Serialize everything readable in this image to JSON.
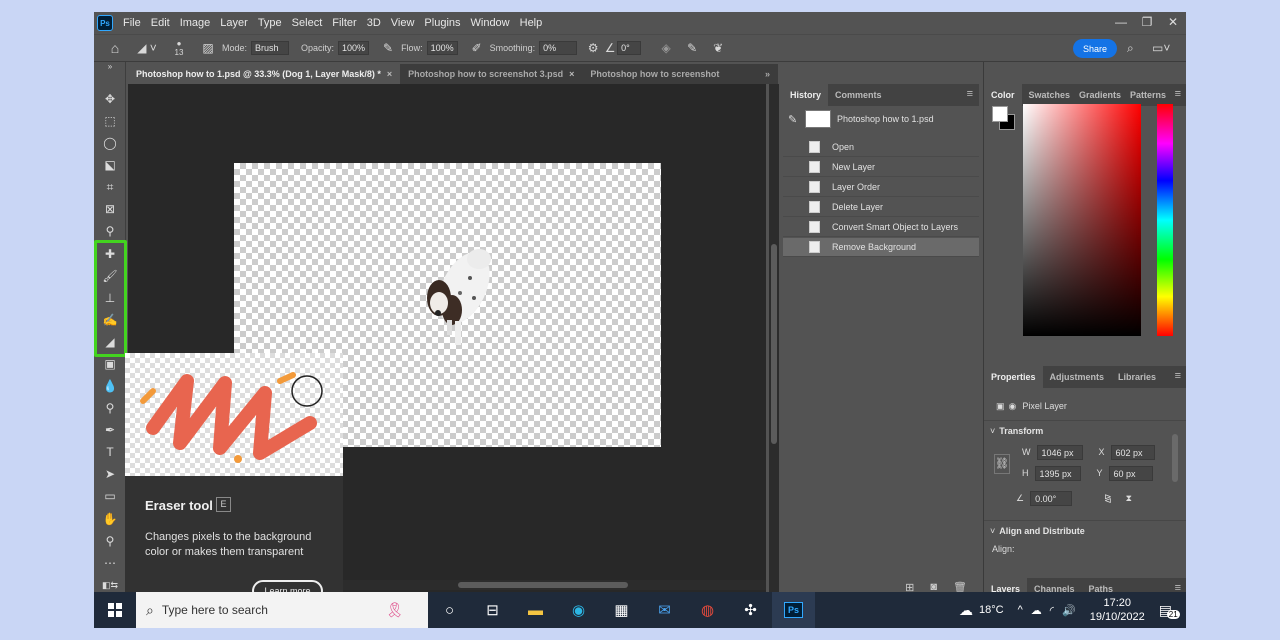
{
  "menubar": {
    "logo": "Ps",
    "items": [
      "File",
      "Edit",
      "Image",
      "Layer",
      "Type",
      "Select",
      "Filter",
      "3D",
      "View",
      "Plugins",
      "Window",
      "Help"
    ]
  },
  "options": {
    "brush_size": "13",
    "mode_label": "Mode:",
    "mode_value": "Brush",
    "opacity_label": "Opacity:",
    "opacity_value": "100%",
    "flow_label": "Flow:",
    "flow_value": "100%",
    "smoothing_label": "Smoothing:",
    "smoothing_value": "0%",
    "angle_value": "0°",
    "share_label": "Share"
  },
  "tabs": [
    {
      "label": "Photoshop how to 1.psd @ 33.3% (Dog 1, Layer Mask/8) *",
      "active": true,
      "close": "×"
    },
    {
      "label": "Photoshop how to screenshot 3.psd",
      "active": false,
      "close": "×"
    },
    {
      "label": "Photoshop how to screenshot",
      "active": false,
      "close": ""
    }
  ],
  "tabs_overflow": "»",
  "tooltip": {
    "title": "Eraser tool",
    "shortcut": "E",
    "description": "Changes pixels to the background color or makes them transparent",
    "button": "Learn more"
  },
  "history_panel": {
    "tabs": [
      "History",
      "Comments"
    ],
    "snapshot": "Photoshop how to 1.psd",
    "steps": [
      "Open",
      "New Layer",
      "Layer Order",
      "Delete Layer",
      "Convert Smart Object to Layers",
      "Remove Background"
    ],
    "selected_index": 5
  },
  "color_panel": {
    "tabs": [
      "Color",
      "Swatches",
      "Gradients",
      "Patterns"
    ],
    "foreground": "#ffffff",
    "background": "#000000"
  },
  "properties_panel": {
    "tabs": [
      "Properties",
      "Adjustments",
      "Libraries"
    ],
    "layer_type": "Pixel Layer",
    "transform_title": "Transform",
    "w_label": "W",
    "w_value": "1046 px",
    "h_label": "H",
    "h_value": "1395 px",
    "x_label": "X",
    "x_value": "602 px",
    "y_label": "Y",
    "y_value": "60 px",
    "angle_value": "0.00°",
    "align_title": "Align and Distribute",
    "align_label": "Align:"
  },
  "layers_panel": {
    "tabs": [
      "Layers",
      "Channels",
      "Paths"
    ]
  },
  "taskbar": {
    "search_placeholder": "Type here to search",
    "weather": "18°C",
    "time": "17:20",
    "date": "19/10/2022",
    "notifications": "21",
    "apps": [
      "task-view-icon",
      "widgets-icon",
      "file-explorer-icon",
      "edge-icon",
      "store-icon",
      "mail-icon",
      "chrome-icon",
      "slack-icon",
      "photoshop-icon"
    ]
  },
  "colors": {
    "accent_blue": "#1473e6",
    "highlight_green": "#43d41f",
    "panel_bg": "#535353",
    "canvas_bg": "#282828"
  }
}
